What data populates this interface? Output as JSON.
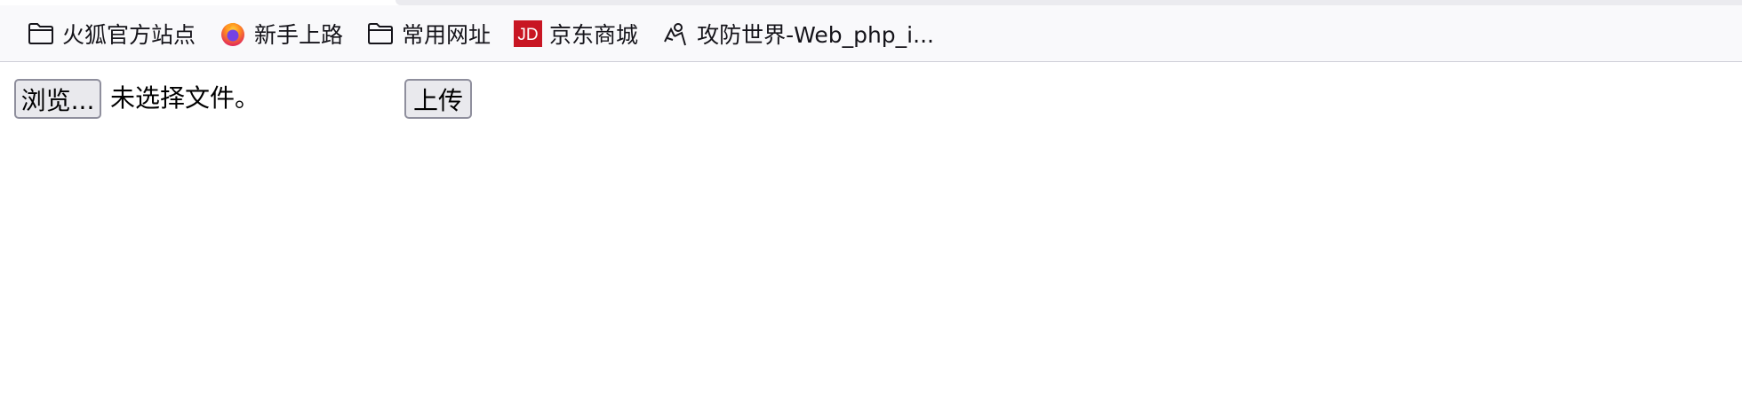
{
  "bookmarks": [
    {
      "label": "火狐官方站点",
      "icon": "folder-icon"
    },
    {
      "label": "新手上路",
      "icon": "firefox-icon"
    },
    {
      "label": "常用网址",
      "icon": "folder-icon"
    },
    {
      "label": "京东商城",
      "icon": "jd-logo-icon",
      "icon_text": "JD",
      "color": "#c81623"
    },
    {
      "label": "攻防世界-Web_php_i...",
      "icon": "adworld-logo-icon"
    }
  ],
  "form": {
    "browse_label": "浏览...",
    "no_file_text": "未选择文件。",
    "upload_label": "上传"
  }
}
